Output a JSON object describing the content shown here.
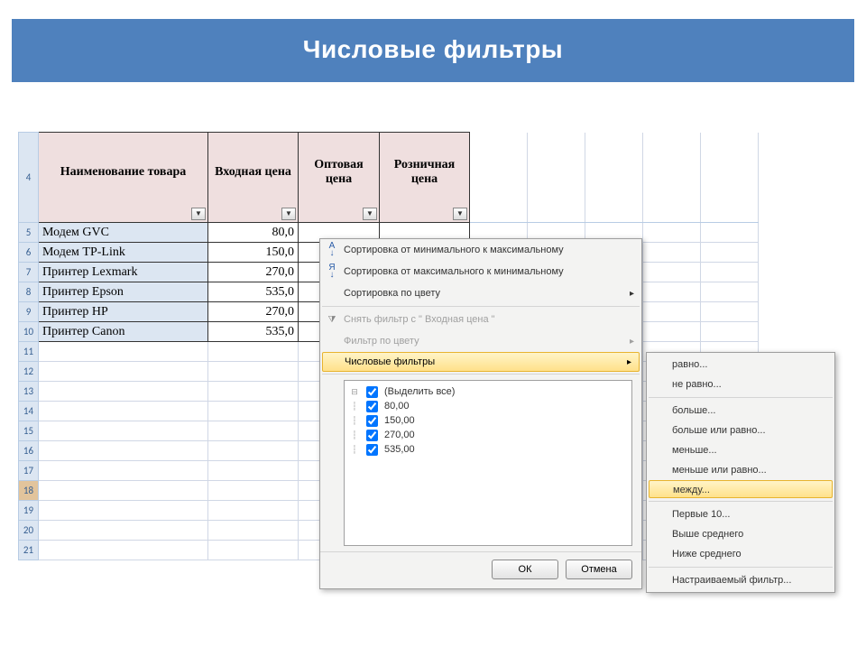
{
  "page_title": "Числовые фильтры",
  "headers": {
    "row": "4",
    "col1": "Наименование товара",
    "col2": "Входная цена",
    "col3": "Оптовая цена",
    "col4": "Розничная цена"
  },
  "rows": [
    {
      "n": "5",
      "name": "Модем GVC",
      "price": "80,0"
    },
    {
      "n": "6",
      "name": "Модем TP-Link",
      "price": "150,0"
    },
    {
      "n": "7",
      "name": "Принтер Lexmark",
      "price": "270,0"
    },
    {
      "n": "8",
      "name": "Принтер Epson",
      "price": "535,0"
    },
    {
      "n": "9",
      "name": "Принтер HP",
      "price": "270,0"
    },
    {
      "n": "10",
      "name": "Принтер Canon",
      "price": "535,0"
    }
  ],
  "empty_rows": [
    "11",
    "12",
    "13",
    "14",
    "15",
    "16",
    "17",
    "18",
    "19",
    "20",
    "21"
  ],
  "filter_menu": {
    "sort_asc": "Сортировка от минимального к максимальному",
    "sort_desc": "Сортировка от максимального к минимальному",
    "sort_color": "Сортировка по цвету",
    "clear_filter": "Снять фильтр с \" Входная цена \"",
    "filter_color": "Фильтр по цвету",
    "number_filters": "Числовые фильтры",
    "check_all": "(Выделить все)",
    "values": [
      "80,00",
      "150,00",
      "270,00",
      "535,00"
    ],
    "ok": "ОК",
    "cancel": "Отмена"
  },
  "submenu": {
    "equals": "равно...",
    "not_equals": "не равно...",
    "greater": "больше...",
    "greater_eq": "больше или равно...",
    "less": "меньше...",
    "less_eq": "меньше или равно...",
    "between": "между...",
    "top10": "Первые 10...",
    "above_avg": "Выше среднего",
    "below_avg": "Ниже среднего",
    "custom": "Настраиваемый фильтр..."
  }
}
